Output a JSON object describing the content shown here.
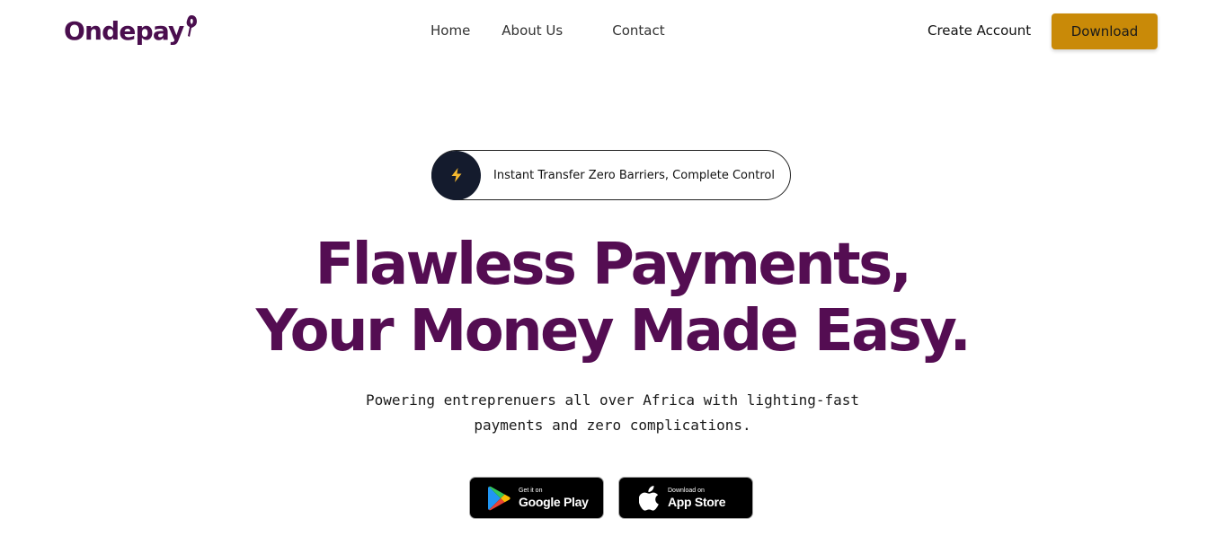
{
  "header": {
    "logo_text": "Ondepay",
    "nav": [
      {
        "label": "Home"
      },
      {
        "label": "About Us"
      },
      {
        "label": "Contact"
      }
    ],
    "create_account_label": "Create Account",
    "download_label": "Download"
  },
  "hero": {
    "pill_icon": "lightning-bolt-icon",
    "pill_text": "Instant Transfer Zero Barriers, Complete Control",
    "headline_line1": "Flawless Payments,",
    "headline_line2": "Your Money Made Easy.",
    "subtitle_line1": "Powering entreprenuers all over Africa with lighting-fast",
    "subtitle_line2": "payments and zero complications."
  },
  "stores": {
    "google": {
      "small": "Get it on",
      "big": "Google Play",
      "icon": "google-play-icon"
    },
    "apple": {
      "small": "Download on",
      "big": "App Store",
      "icon": "apple-icon"
    }
  },
  "colors": {
    "brand_purple": "#540d52",
    "accent_gold": "#c98a08",
    "pill_icon_bg": "#141b2d",
    "bolt": "#f5b82e"
  }
}
